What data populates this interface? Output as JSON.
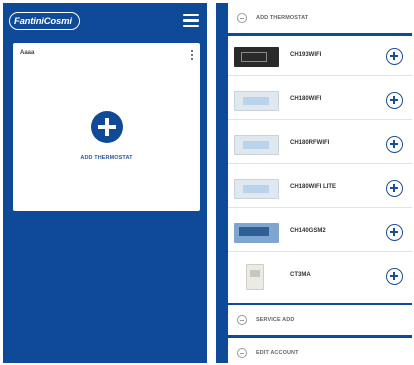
{
  "app": {
    "logo_text": "FantiniCosmi"
  },
  "left": {
    "card": {
      "title": "Aaaa",
      "add_label": "ADD THERMOSTAT"
    }
  },
  "right": {
    "sections": {
      "add_thermostat": "ADD THERMOSTAT",
      "service_add": "SERVICE ADD",
      "edit_account": "EDIT ACCOUNT"
    },
    "thermostats": [
      {
        "label": "CH193WIFI",
        "thumb": "dark"
      },
      {
        "label": "CH180WIFI",
        "thumb": "light"
      },
      {
        "label": "CH180RFWIFI",
        "thumb": "light"
      },
      {
        "label": "CH180WIFI LITE",
        "thumb": "light"
      },
      {
        "label": "CH140GSM2",
        "thumb": "blue"
      },
      {
        "label": "CT3MA",
        "thumb": "small"
      }
    ]
  },
  "colors": {
    "brand_blue": "#0f4a98",
    "accent_blue": "#1b4e99"
  }
}
